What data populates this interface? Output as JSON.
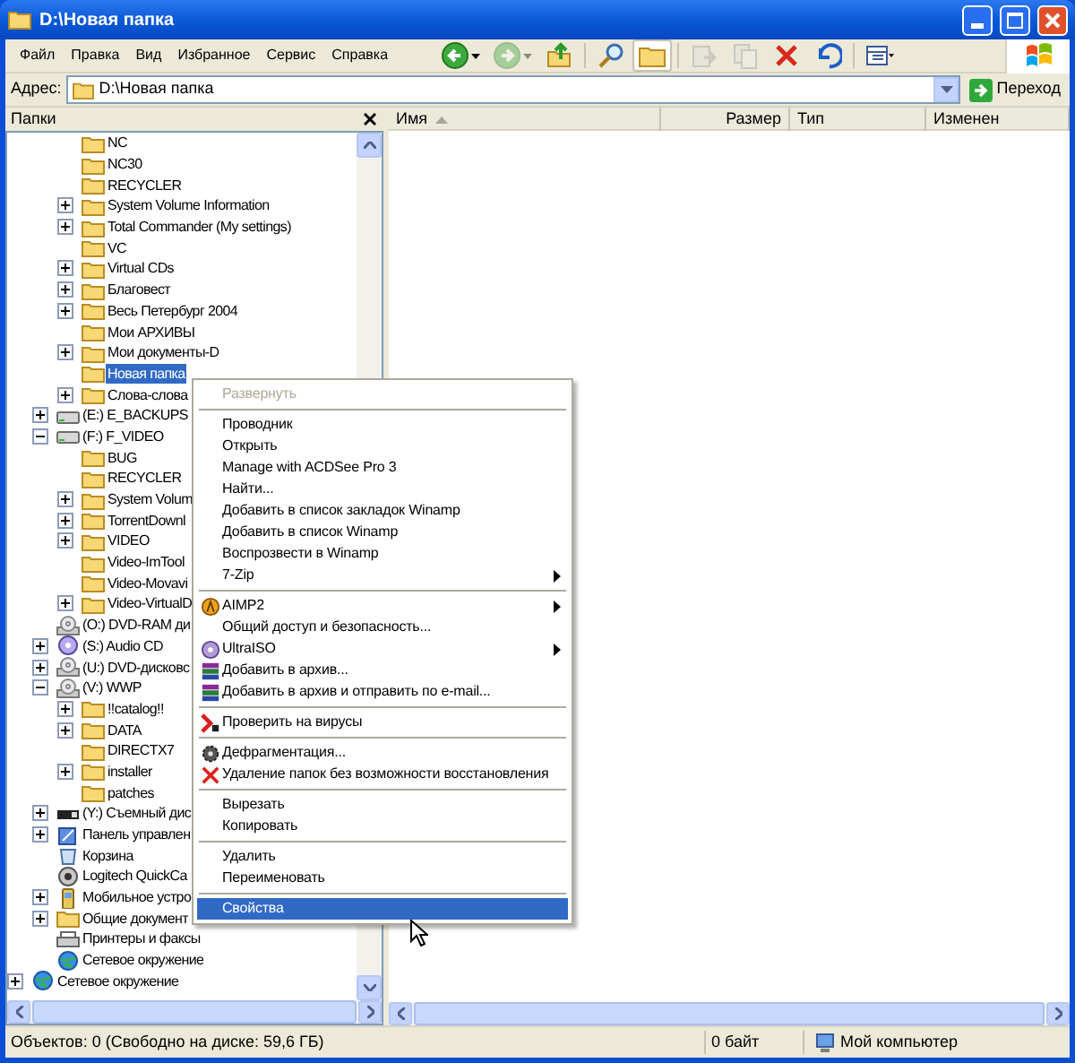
{
  "window": {
    "title": "D:\\Новая папка"
  },
  "menu_bar": [
    "Файл",
    "Правка",
    "Вид",
    "Избранное",
    "Сервис",
    "Справка"
  ],
  "toolbar": [
    {
      "kind": "back",
      "disabled": false,
      "selected": false
    },
    {
      "kind": "forward",
      "disabled": true,
      "selected": false
    },
    {
      "kind": "up",
      "disabled": false,
      "selected": false
    },
    {
      "kind": "separator"
    },
    {
      "kind": "search",
      "disabled": false,
      "selected": false
    },
    {
      "kind": "folders",
      "disabled": false,
      "selected": true
    },
    {
      "kind": "separator"
    },
    {
      "kind": "move",
      "disabled": true,
      "selected": false
    },
    {
      "kind": "copy",
      "disabled": true,
      "selected": false
    },
    {
      "kind": "delete",
      "disabled": false,
      "selected": false
    },
    {
      "kind": "undo",
      "disabled": false,
      "selected": false
    },
    {
      "kind": "separator"
    },
    {
      "kind": "views",
      "disabled": false,
      "selected": false
    }
  ],
  "address": {
    "label": "Адрес:",
    "value": "D:\\Новая папка",
    "go_button": "Переход"
  },
  "folders_pane": {
    "title": "Папки",
    "tree": [
      {
        "children": [
          {
            "children": [
              {
                "label": "NC",
                "kind": "folder",
                "selected": false
              },
              {
                "label": "NC30",
                "kind": "folder",
                "selected": false
              },
              {
                "label": "RECYCLER",
                "kind": "folder",
                "selected": false
              },
              {
                "label": "System Volume Information",
                "kind": "folder",
                "expanded": false,
                "selected": false
              },
              {
                "label": "Total Commander (My settings)",
                "kind": "folder",
                "expanded": false,
                "selected": false
              },
              {
                "label": "VC",
                "kind": "folder",
                "selected": false
              },
              {
                "label": "Virtual CDs",
                "kind": "folder",
                "expanded": false,
                "selected": false
              },
              {
                "label": "Благовест",
                "kind": "folder",
                "expanded": false,
                "selected": false
              },
              {
                "label": "Весь Петербург 2004",
                "kind": "folder",
                "expanded": false,
                "selected": false
              },
              {
                "label": "Мои АРХИВЫ",
                "kind": "folder",
                "selected": false
              },
              {
                "label": "Мои документы-D",
                "kind": "folder",
                "expanded": false,
                "selected": false
              },
              {
                "label": "Новая папка",
                "kind": "folder",
                "selected": true
              },
              {
                "label": "Слова-слова",
                "kind": "folder",
                "expanded": false,
                "selected": false
              }
            ]
          },
          {
            "label": "(E:) E_BACKUPS",
            "kind": "drive",
            "expanded": false,
            "selected": false
          },
          {
            "label": "(F:) F_VIDEO",
            "kind": "drive",
            "expanded": true,
            "selected": false,
            "children": [
              {
                "label": "BUG",
                "kind": "folder",
                "selected": false
              },
              {
                "label": "RECYCLER",
                "kind": "folder",
                "selected": false
              },
              {
                "label": "System Volum",
                "kind": "folder",
                "expanded": false,
                "selected": false
              },
              {
                "label": "TorrentDownl",
                "kind": "folder",
                "expanded": false,
                "selected": false
              },
              {
                "label": "VIDEO",
                "kind": "folder",
                "expanded": false,
                "selected": false
              },
              {
                "label": "Video-ImTool",
                "kind": "folder",
                "selected": false
              },
              {
                "label": "Video-Movavi",
                "kind": "folder",
                "selected": false
              },
              {
                "label": "Video-VirtualD",
                "kind": "folder",
                "expanded": false,
                "selected": false
              }
            ]
          },
          {
            "label": "(O:) DVD-RAM ди",
            "kind": "cdrom",
            "selected": false
          },
          {
            "label": "(S:) Audio CD",
            "kind": "audiocd",
            "expanded": false,
            "selected": false
          },
          {
            "label": "(U:) DVD-дисковс",
            "kind": "cdrom",
            "expanded": false,
            "selected": false
          },
          {
            "label": "(V:) WWP",
            "kind": "cdrom",
            "expanded": true,
            "selected": false,
            "children": [
              {
                "label": "!!catalog!!",
                "kind": "folder",
                "expanded": false,
                "selected": false
              },
              {
                "label": "DATA",
                "kind": "folder",
                "expanded": false,
                "selected": false
              },
              {
                "label": "DIRECTX7",
                "kind": "folder",
                "selected": false
              },
              {
                "label": "installer",
                "kind": "folder",
                "expanded": false,
                "selected": false
              },
              {
                "label": "patches",
                "kind": "folder",
                "selected": false
              }
            ]
          },
          {
            "label": "(Y:) Съемный дис",
            "kind": "removable",
            "expanded": false,
            "selected": false
          },
          {
            "label": "Панель управлен",
            "kind": "control",
            "expanded": false,
            "selected": false
          },
          {
            "label": "Корзина",
            "kind": "recycle",
            "selected": false
          },
          {
            "label": "Logitech QuickCa",
            "kind": "camera",
            "selected": false
          },
          {
            "label": "Мобильное устро",
            "kind": "mobile",
            "expanded": false,
            "selected": false
          },
          {
            "label": "Общие документ",
            "kind": "folder",
            "expanded": false,
            "selected": false
          },
          {
            "label": "Принтеры и факсы",
            "kind": "printer",
            "selected": false
          },
          {
            "label": "Сетевое окружение",
            "kind": "network",
            "selected": false
          }
        ]
      },
      {
        "label": "Сетевое окружение",
        "kind": "network",
        "expanded": false,
        "selected": false
      }
    ]
  },
  "file_list": {
    "columns": [
      {
        "label": "Имя",
        "sorted": true
      },
      {
        "label": "Размер",
        "sorted": false
      },
      {
        "label": "Тип",
        "sorted": false
      },
      {
        "label": "Изменен",
        "sorted": false
      }
    ]
  },
  "context_menu": {
    "items": [
      {
        "kind": "plain",
        "label": "Развернуть",
        "disabled": true,
        "selected": false,
        "submenu": false
      },
      {
        "kind": "separator"
      },
      {
        "kind": "plain",
        "label": "Проводник",
        "disabled": false,
        "selected": false,
        "submenu": false
      },
      {
        "kind": "plain",
        "label": "Открыть",
        "disabled": false,
        "selected": false,
        "submenu": false
      },
      {
        "kind": "plain",
        "label": "Manage with ACDSee Pro 3",
        "disabled": false,
        "selected": false,
        "submenu": false
      },
      {
        "kind": "plain",
        "label": "Найти...",
        "disabled": false,
        "selected": false,
        "submenu": false
      },
      {
        "kind": "plain",
        "label": "Добавить в список закладок Winamp",
        "disabled": false,
        "selected": false,
        "submenu": false
      },
      {
        "kind": "plain",
        "label": "Добавить в список Winamp",
        "disabled": false,
        "selected": false,
        "submenu": false
      },
      {
        "kind": "plain",
        "label": "Воспрозвести в Winamp",
        "disabled": false,
        "selected": false,
        "submenu": false
      },
      {
        "kind": "plain",
        "label": "7-Zip",
        "disabled": false,
        "selected": false,
        "submenu": true
      },
      {
        "kind": "separator"
      },
      {
        "kind": "aimp",
        "label": "AIMP2",
        "disabled": false,
        "selected": false,
        "submenu": true
      },
      {
        "kind": "plain",
        "label": "Общий доступ и безопасность...",
        "disabled": false,
        "selected": false,
        "submenu": false
      },
      {
        "kind": "disc",
        "label": "UltraISO",
        "disabled": false,
        "selected": false,
        "submenu": true
      },
      {
        "kind": "archive",
        "label": "Добавить в архив...",
        "disabled": false,
        "selected": false,
        "submenu": false
      },
      {
        "kind": "archive",
        "label": "Добавить в архив и отправить по e-mail...",
        "disabled": false,
        "selected": false,
        "submenu": false
      },
      {
        "kind": "separator"
      },
      {
        "kind": "antivirus",
        "label": "Проверить на вирусы",
        "disabled": false,
        "selected": false,
        "submenu": false
      },
      {
        "kind": "separator"
      },
      {
        "kind": "defrag",
        "label": "Дефрагментация...",
        "disabled": false,
        "selected": false,
        "submenu": false
      },
      {
        "kind": "shred",
        "label": "Удаление папок без возможности восстановления",
        "disabled": false,
        "selected": false,
        "submenu": false
      },
      {
        "kind": "separator"
      },
      {
        "kind": "plain",
        "label": "Вырезать",
        "disabled": false,
        "selected": false,
        "submenu": false
      },
      {
        "kind": "plain",
        "label": "Копировать",
        "disabled": false,
        "selected": false,
        "submenu": false
      },
      {
        "kind": "separator"
      },
      {
        "kind": "plain",
        "label": "Удалить",
        "disabled": false,
        "selected": false,
        "submenu": false
      },
      {
        "kind": "plain",
        "label": "Переименовать",
        "disabled": false,
        "selected": false,
        "submenu": false
      },
      {
        "kind": "separator"
      },
      {
        "kind": "plain",
        "label": "Свойства",
        "disabled": false,
        "selected": true,
        "submenu": false
      }
    ]
  },
  "status_bar": {
    "objects": "Объектов: 0 (Свободно на диске: 59,6 ГБ)",
    "size": "0 байт",
    "zone": "Мой компьютер"
  }
}
